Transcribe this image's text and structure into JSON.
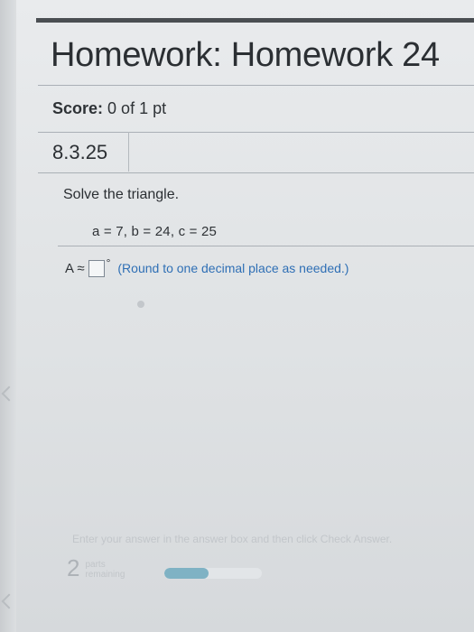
{
  "header": {
    "title": "Homework: Homework 24"
  },
  "score": {
    "label": "Score:",
    "value": "0 of 1 pt"
  },
  "question": {
    "id": "8.3.25",
    "prompt": "Solve the triangle.",
    "givens": "a = 7, b = 24, c = 25",
    "answer_label": "A ≈",
    "answer_value": "",
    "degree_symbol": "°",
    "hint": "(Round to one decimal place as needed.)"
  },
  "footer": {
    "instructions": "Enter your answer in the answer box and then click Check Answer.",
    "parts_count": "2",
    "parts_line1": "parts",
    "parts_line2": "remaining",
    "progress_fraction": 0.45,
    "progress_color": "#7fb2c4"
  }
}
